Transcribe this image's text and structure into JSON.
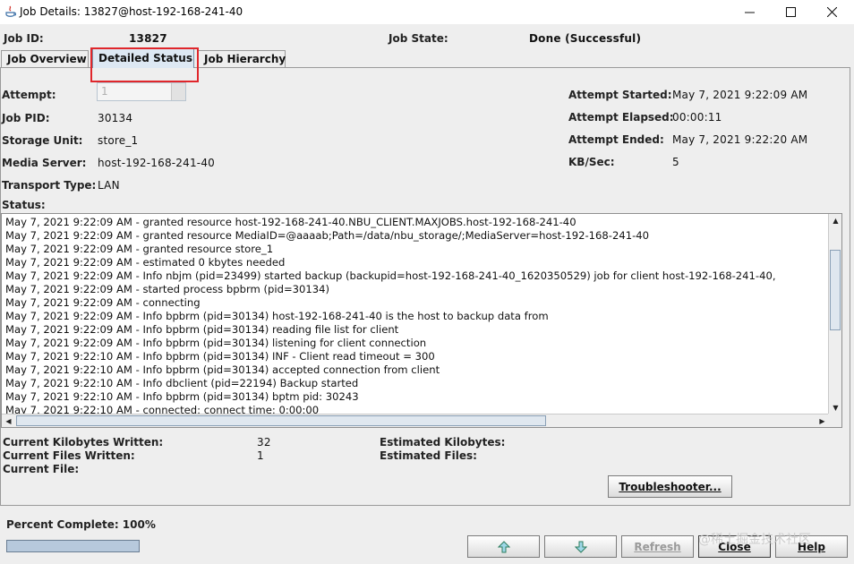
{
  "window": {
    "title": "Job Details: 13827@host-192-168-241-40",
    "controls": {
      "minimize": "─",
      "maximize": "☐",
      "close": "✕"
    }
  },
  "header": {
    "job_id_label": "Job ID:",
    "job_id_value": "13827",
    "job_state_label": "Job State:",
    "job_state_value": "Done (Successful)"
  },
  "tabs": [
    {
      "label": "Job Overview",
      "active": false
    },
    {
      "label": "Detailed Status",
      "active": true
    },
    {
      "label": "Job Hierarchy",
      "active": false
    }
  ],
  "details_left": {
    "attempt_label": "Attempt:",
    "attempt_value": "1",
    "job_pid_label": "Job PID:",
    "job_pid_value": "30134",
    "storage_unit_label": "Storage Unit:",
    "storage_unit_value": "store_1",
    "media_server_label": "Media Server:",
    "media_server_value": "host-192-168-241-40",
    "transport_type_label": "Transport Type:",
    "transport_type_value": "LAN"
  },
  "details_right": {
    "attempt_started_label": "Attempt Started:",
    "attempt_started_value": "May 7, 2021 9:22:09 AM",
    "attempt_elapsed_label": "Attempt Elapsed:",
    "attempt_elapsed_value": "00:00:11",
    "attempt_ended_label": "Attempt Ended:",
    "attempt_ended_value": "May 7, 2021 9:22:20 AM",
    "kbsec_label": "KB/Sec:",
    "kbsec_value": "5"
  },
  "status": {
    "label": "Status:",
    "lines": [
      "May 7, 2021 9:22:09 AM - granted resource  host-192-168-241-40.NBU_CLIENT.MAXJOBS.host-192-168-241-40",
      "May 7, 2021 9:22:09 AM - granted resource  MediaID=@aaaab;Path=/data/nbu_storage/;MediaServer=host-192-168-241-40",
      "May 7, 2021 9:22:09 AM - granted resource  store_1",
      "May 7, 2021 9:22:09 AM - estimated 0 kbytes needed",
      "May 7, 2021 9:22:09 AM - Info nbjm (pid=23499) started backup (backupid=host-192-168-241-40_1620350529) job for client host-192-168-241-40,",
      "May 7, 2021 9:22:09 AM - started process bpbrm (pid=30134)",
      "May 7, 2021 9:22:09 AM - connecting",
      "May 7, 2021 9:22:09 AM - Info bpbrm (pid=30134) host-192-168-241-40 is the host to backup data from",
      "May 7, 2021 9:22:09 AM - Info bpbrm (pid=30134) reading file list for client",
      "May 7, 2021 9:22:09 AM - Info bpbrm (pid=30134) listening for client connection",
      "May 7, 2021 9:22:10 AM - Info bpbrm (pid=30134) INF - Client read timeout = 300",
      "May 7, 2021 9:22:10 AM - Info bpbrm (pid=30134) accepted connection from client",
      "May 7, 2021 9:22:10 AM - Info dbclient (pid=22194) Backup started",
      "May 7, 2021 9:22:10 AM - Info bpbrm (pid=30134) bptm pid: 30243",
      "May 7, 2021 9:22:10 AM - connected; connect time: 0:00:00"
    ]
  },
  "summary": {
    "kb_written_label": "Current Kilobytes Written:",
    "kb_written_value": "32",
    "files_written_label": "Current Files Written:",
    "files_written_value": "1",
    "current_file_label": "Current File:",
    "est_kb_label": "Estimated Kilobytes:",
    "est_files_label": "Estimated Files:"
  },
  "troubleshooter_label": "Troubleshooter...",
  "percent_complete_label": "Percent Complete: 100%",
  "percent_complete_value": 1.0,
  "buttons": {
    "refresh": "Refresh",
    "close": "Close",
    "help": "Help"
  },
  "watermark": "@稀土掘金技术社区",
  "colors": {
    "active_tab": "#dde8f3",
    "highlight_box": "#e0262b",
    "progress_fill": "#b7c9dc"
  }
}
